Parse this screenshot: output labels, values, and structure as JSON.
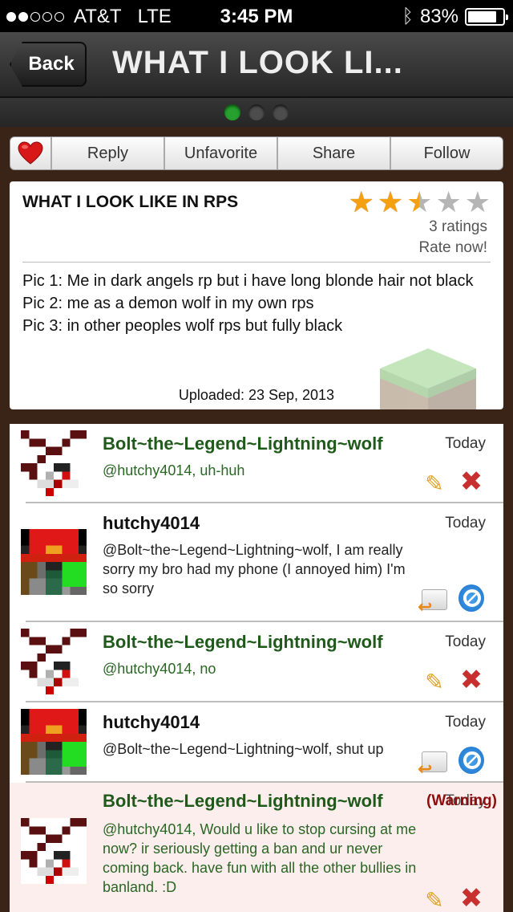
{
  "status_bar": {
    "carrier": "AT&T",
    "network": "LTE",
    "time": "3:45 PM",
    "battery": "83%",
    "battery_level": 0.83,
    "signal_bars": 2
  },
  "nav": {
    "back_label": "Back",
    "title": "WHAT I LOOK LI..."
  },
  "pager": {
    "pages": 3,
    "active": 0
  },
  "toolbar": {
    "favorite_icon": "heart-icon",
    "reply": "Reply",
    "unfavorite": "Unfavorite",
    "share": "Share",
    "follow": "Follow"
  },
  "post": {
    "title": "WHAT I LOOK LIKE IN RPS",
    "rating_stars": 2.5,
    "ratings_count": "3 ratings",
    "rate_now": "Rate now!",
    "lines": [
      "Pic 1: Me in dark angels rp but i have long blonde hair not black",
      "Pic 2: me as a demon wolf in my own rps",
      "Pic 3: in other peoples wolf rps but fully black"
    ],
    "uploaded": "Uploaded: 23 Sep, 2013"
  },
  "comments": [
    {
      "author": "Bolt~the~Legend~Lightning~wolf",
      "time": "Today",
      "text": "@hutchy4014, uh-huh",
      "actions": [
        "pencil-icon",
        "delete-icon"
      ]
    },
    {
      "author": "hutchy4014",
      "time": "Today",
      "text": "@Bolt~the~Legend~Lightning~wolf, I am really sorry my bro had my phone (I annoyed him) I'm so sorry",
      "actions": [
        "reply-icon",
        "block-icon"
      ]
    },
    {
      "author": "Bolt~the~Legend~Lightning~wolf",
      "time": "Today",
      "text": "@hutchy4014, no",
      "actions": [
        "pencil-icon",
        "delete-icon"
      ]
    },
    {
      "author": "hutchy4014",
      "time": "Today",
      "text": "@Bolt~the~Legend~Lightning~wolf, shut up",
      "actions": [
        "reply-icon",
        "block-icon"
      ]
    },
    {
      "author": "Bolt~the~Legend~Lightning~wolf",
      "time": "Today",
      "warning": "(Warning)",
      "text": "@hutchy4014, Would u like to stop cursing at me now? ir seriously getting a ban and ur never coming back. have fun with all the other bullies in banland. :D",
      "actions": [
        "pencil-icon",
        "delete-icon"
      ]
    }
  ],
  "colors": {
    "accent_green": "#27a030",
    "author_green": "#1f5a1b",
    "star": "#f5a010",
    "warning": "#8c0e0e"
  }
}
